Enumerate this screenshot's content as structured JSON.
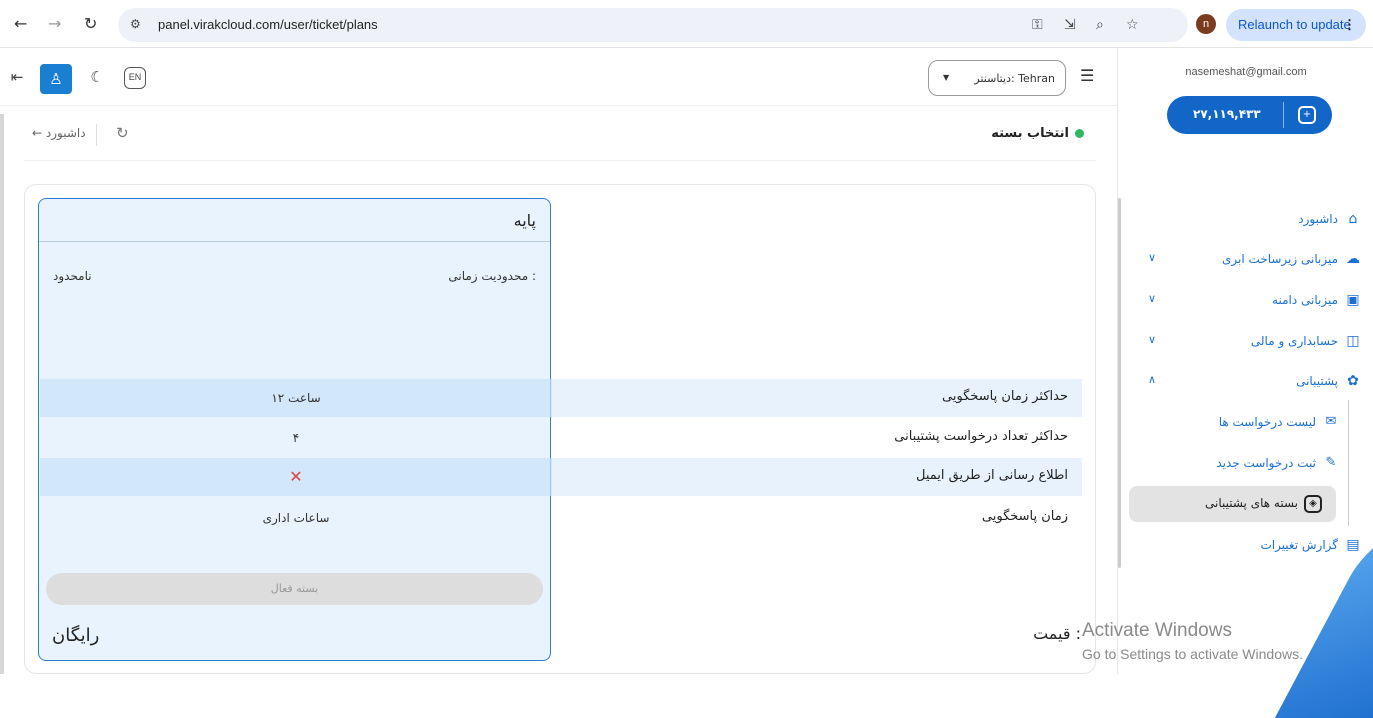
{
  "browser": {
    "url": "panel.virakcloud.com/user/ticket/plans",
    "relaunch_label": "Relaunch to update",
    "profile_initial": "n"
  },
  "sidebar": {
    "email": "nasemeshat@gmail.com",
    "wallet_amount": "۲۷,۱۱۹,۴۳۳",
    "items": [
      {
        "label": "داشبورد",
        "icon": "home-icon"
      },
      {
        "label": "میزبانی زیرساخت ابری",
        "icon": "cloud-icon"
      },
      {
        "label": "میزبانی دامنه",
        "icon": "dns-icon"
      },
      {
        "label": "حسابداری و مالی",
        "icon": "wallet-icon"
      },
      {
        "label": "پشتیبانی",
        "icon": "support-icon"
      }
    ],
    "support_sub": [
      {
        "label": "لیست درخواست ها",
        "icon": "envelope-icon"
      },
      {
        "label": "ثبت درخواست جدید",
        "icon": "chat-icon"
      },
      {
        "label": "بسته های پشتیبانی",
        "icon": "package-icon"
      }
    ],
    "changelog_label": "گزارش تغییرات"
  },
  "topbar": {
    "datacenter_label": "دیتاسنتر: Tehran",
    "lang_label": "EN"
  },
  "breadcrumb": {
    "back_label": "داشبورد",
    "title": "انتخاب بسته"
  },
  "features": [
    {
      "label": "حداکثر زمان پاسخگویی",
      "value": "۱۲ ساعت"
    },
    {
      "label": "حداکثر تعداد درخواست پشتیبانی",
      "value": "۴"
    },
    {
      "label": "اطلاع رسانی از طریق ایمیل",
      "value": "✕"
    },
    {
      "label": "زمان پاسخگویی",
      "value": "ساعات اداری"
    }
  ],
  "plan": {
    "name": "پایه",
    "time_limit_label": "محدودیت زمانی :",
    "time_limit_value": "نامحدود",
    "active_button": "بسته فعال",
    "price": "رایگان"
  },
  "price_label": "قیمت :",
  "watermark": {
    "line1": "Activate Windows",
    "line2": "Go to Settings to activate Windows."
  }
}
